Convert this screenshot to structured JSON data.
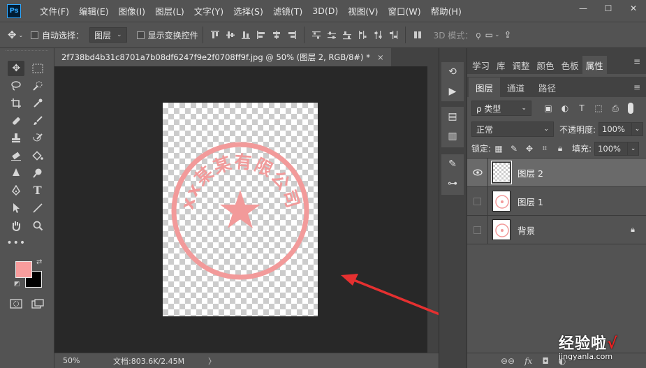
{
  "app": {
    "logo": "Ps"
  },
  "menu": [
    "文件(F)",
    "编辑(E)",
    "图像(I)",
    "图层(L)",
    "文字(Y)",
    "选择(S)",
    "滤镜(T)",
    "3D(D)",
    "视图(V)",
    "窗口(W)",
    "帮助(H)"
  ],
  "window_controls": {
    "minimize": "—",
    "maximize": "☐",
    "close": "✕"
  },
  "options": {
    "auto_select_label": "自动选择：",
    "auto_select_value": "图层",
    "show_transform_label": "显示变换控件",
    "mode_3d_label": "3D 模式："
  },
  "document": {
    "tab_title": "2f738bd4b31c8701a7b08df6247f9e2f0708ff9f.jpg @ 50% (图层 2, RGB/8#) *",
    "close": "×",
    "zoom": "50%",
    "doc_info": "文档:803.6K/2.45M",
    "status_more": "〉"
  },
  "stamp": {
    "text": "xx某某有限公司",
    "color": "#f29a9a"
  },
  "colors": {
    "foreground": "#f89d9d",
    "background": "#000000",
    "accent_arrow": "#e53030"
  },
  "panels": {
    "top_tabs": [
      "学习",
      "库",
      "调整",
      "颜色",
      "色板",
      "属性"
    ],
    "active_top_tab": "属性",
    "layer_tabs": [
      "图层",
      "通道",
      "路径"
    ],
    "active_layer_tab": "图层",
    "filter_kind": "ρ 类型",
    "blend_mode": "正常",
    "opacity_label": "不透明度:",
    "opacity_value": "100%",
    "lock_label": "锁定:",
    "fill_label": "填充:",
    "fill_value": "100%",
    "layers": [
      {
        "name": "图层 2",
        "visible": true,
        "selected": true
      },
      {
        "name": "图层 1",
        "visible": false,
        "selected": false
      },
      {
        "name": "背景",
        "visible": false,
        "selected": false,
        "locked": true
      }
    ],
    "footer_icons": [
      "link-icon",
      "fx-icon",
      "mask-icon",
      "adjustment-icon"
    ]
  },
  "watermark": {
    "main": "经验啦",
    "check": "√",
    "sub": "jingyanla.com"
  }
}
